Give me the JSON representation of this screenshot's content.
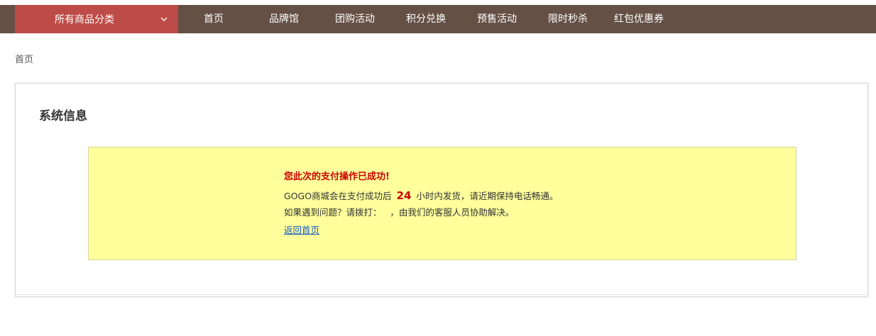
{
  "nav": {
    "category_label": "所有商品分类",
    "items": [
      "首页",
      "品牌馆",
      "团购活动",
      "积分兑换",
      "预售活动",
      "限时秒杀",
      "红包优惠券"
    ]
  },
  "breadcrumb": "首页",
  "panel": {
    "title": "系统信息",
    "message": {
      "heading": "您此次的支付操作已成功!",
      "line1_before": "GOGO商城会在支付成功后",
      "hours": "24",
      "line1_after": "小时内发货，请近期保持电话畅通。",
      "line2": "如果遇到问题？请拨打：   ，由我们的客服人员协助解决。",
      "link": "返回首页"
    }
  },
  "colors": {
    "navbar_bg": "#645045",
    "category_bg": "#bd4c48",
    "notice_bg": "#ffff9c",
    "success_text": "#cc0000",
    "link": "#1a5cc8"
  }
}
